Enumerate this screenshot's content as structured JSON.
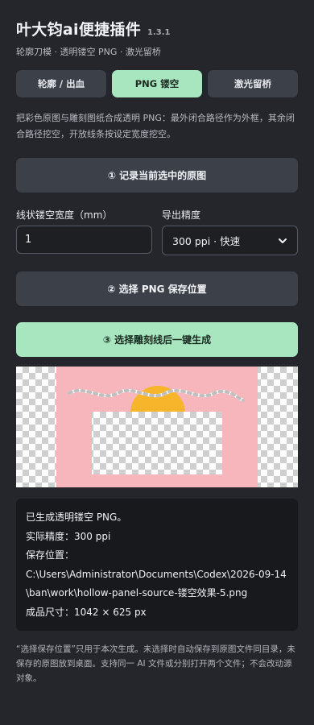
{
  "app": {
    "title": "叶大钧ai便捷插件",
    "version": "1.3.1",
    "subtitle": "轮廓刀模 · 透明镂空 PNG · 激光留桥"
  },
  "tabs": [
    {
      "label": "轮廓 / 出血",
      "active": false
    },
    {
      "label": "PNG 镂空",
      "active": true
    },
    {
      "label": "激光留桥",
      "active": false
    }
  ],
  "description": "把彩色原图与雕刻图纸合成透明 PNG：最外闭合路径作为外框，其余闭合路径挖空，开放线条按设定宽度挖空。",
  "buttons": {
    "record": "① 记录当前选中的原图",
    "save": "② 选择 PNG 保存位置",
    "generate": "③ 选择雕刻线后一键生成"
  },
  "fields": {
    "width_label": "线状镂空宽度（mm）",
    "width_value": "1",
    "precision_label": "导出精度",
    "precision_selected": "300 ppi · 快速"
  },
  "colors": {
    "accent": "#a8e6c0",
    "preview_pink": "#f6b6bb",
    "preview_orange": "#f7b52b"
  },
  "result": {
    "line1": "已生成透明镂空 PNG。",
    "line2": "实际精度：300 ppi",
    "line3": "保存位置：",
    "line4": "C:\\Users\\Administrator\\Documents\\Codex\\2026-09-14\\ban\\work\\hollow-panel-source-镂空效果-5.png",
    "line5": "成品尺寸：1042 × 625 px"
  },
  "footnote": "“选择保存位置”只用于本次生成。未选择时自动保存到原图文件同目录，未保存的原图放到桌面。支持同一 AI 文件或分别打开两个文件；不会改动源对象。",
  "icons": {
    "select_chevron": "chevron-down-icon"
  }
}
